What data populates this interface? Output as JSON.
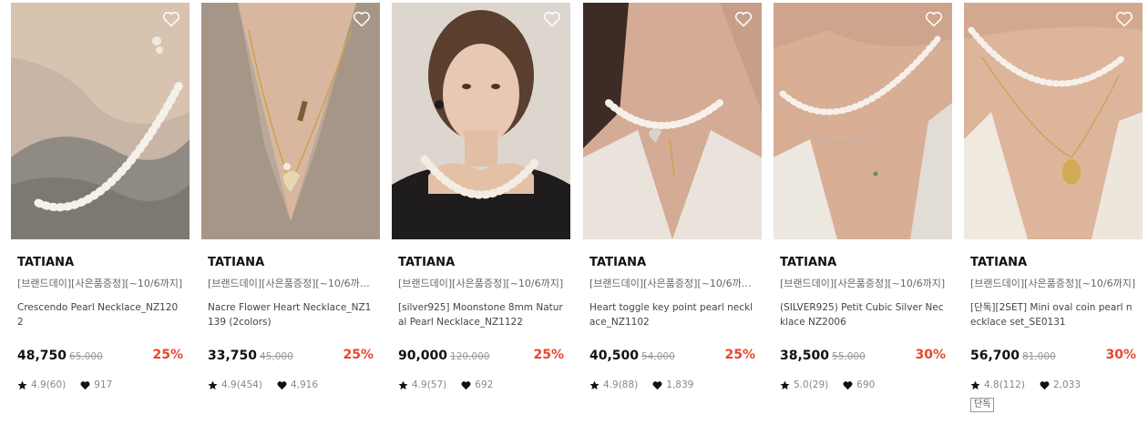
{
  "products": [
    {
      "brand": "TATIANA",
      "promo": "[브랜드데이][사은품증정][~10/6까지]",
      "name": "Crescendo Pearl Necklace_NZ1202",
      "price": "48,750",
      "original_price": "65,000",
      "discount": "25%",
      "rating": "4.9(60)",
      "likes": "917",
      "badge": "",
      "image_alt": "pearl necklace on model wearing grey sweater"
    },
    {
      "brand": "TATIANA",
      "promo": "[브랜드데이][사은품증정][~10/6까지...",
      "name": "Nacre Flower Heart Necklace_NZ1139 (2colors)",
      "price": "33,750",
      "original_price": "45,000",
      "discount": "25%",
      "rating": "4.9(454)",
      "likes": "4,916",
      "badge": "",
      "image_alt": "gold chain heart pendant necklace on knit sweater"
    },
    {
      "brand": "TATIANA",
      "promo": "[브랜드데이][사은품증정][~10/6까지]",
      "name": "[silver925] Moonstone 8mm Natural Pearl Necklace_NZ1122",
      "price": "90,000",
      "original_price": "120,000",
      "discount": "25%",
      "rating": "4.9(57)",
      "likes": "692",
      "badge": "",
      "image_alt": "model wearing pearl necklace and black top"
    },
    {
      "brand": "TATIANA",
      "promo": "[브랜드데이][사은품증정][~10/6까지...",
      "name": "Heart toggle key point pearl necklace_NZ1102",
      "price": "40,500",
      "original_price": "54,000",
      "discount": "25%",
      "rating": "4.9(88)",
      "likes": "1,839",
      "badge": "",
      "image_alt": "pearl choker with heart toggle"
    },
    {
      "brand": "TATIANA",
      "promo": "[브랜드데이][사은품증정][~10/6까지]",
      "name": "(SILVER925) Petit Cubic Silver Necklace NZ2006",
      "price": "38,500",
      "original_price": "55,000",
      "discount": "30%",
      "rating": "5.0(29)",
      "likes": "690",
      "badge": "",
      "image_alt": "layered pearl and silver necklace"
    },
    {
      "brand": "TATIANA",
      "promo": "[단독][2SET] Mini oval coin pearl necklace set_SE0131",
      "promo_line": "[브랜드데이][사은품증정][~10/6까지]",
      "name": "[단독][2SET] Mini oval coin pearl necklace set_SE0131",
      "price": "56,700",
      "original_price": "81,000",
      "discount": "30%",
      "rating": "4.8(112)",
      "likes": "2,033",
      "badge": "단독",
      "image_alt": "pearl necklace with gold oval coin pendant"
    }
  ],
  "colors": {
    "discount": "#e8462a",
    "text": "#111111",
    "muted": "#888888"
  },
  "icons": {
    "wishlist": "heart-outline-icon",
    "rating": "star-icon",
    "likes": "heart-filled-icon"
  }
}
